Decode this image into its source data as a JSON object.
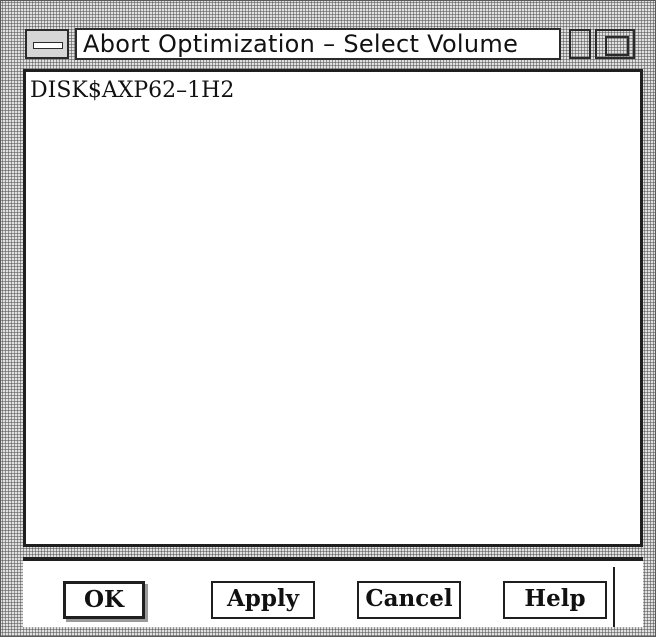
{
  "window": {
    "title": "Abort Optimization – Select Volume",
    "menu_icon": "window-menu-icon",
    "maximize_icon": "maximize-icon"
  },
  "volume_list": {
    "items": [
      {
        "label": "DISK$AXP62–1H2"
      }
    ]
  },
  "buttons": {
    "ok": "OK",
    "apply": "Apply",
    "cancel": "Cancel",
    "help": "Help"
  }
}
